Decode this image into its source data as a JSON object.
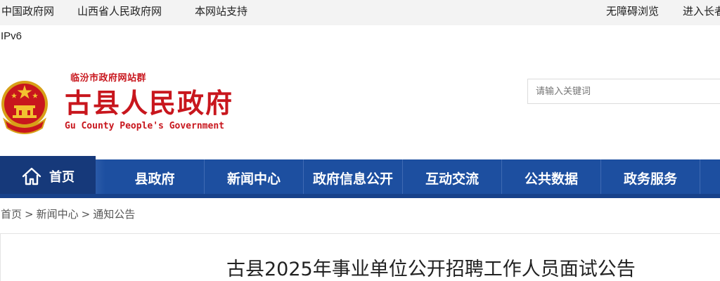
{
  "topbar": {
    "left_links": [
      "中国政府网",
      "山西省人民政府网",
      "本网站支持"
    ],
    "right_links": [
      "无障碍浏览",
      "进入长者"
    ],
    "ipv6": "IPv6"
  },
  "header": {
    "site_group": "临汾市政府网站群",
    "title": "古县人民政府",
    "title_en": "Gu County People's Government",
    "brand_color": "#c8161d"
  },
  "search": {
    "placeholder": "请输入关键词"
  },
  "nav": {
    "home": "首页",
    "items": [
      "县政府",
      "新闻中心",
      "政府信息公开",
      "互动交流",
      "公共数据",
      "政务服务"
    ],
    "bar_color": "#1d4fa0",
    "home_color": "#16397a"
  },
  "breadcrumb": {
    "items": [
      "首页",
      "新闻中心",
      "通知公告"
    ],
    "separator": ">"
  },
  "article": {
    "title": "古县2025年事业单位公开招聘工作人员面试公告"
  }
}
